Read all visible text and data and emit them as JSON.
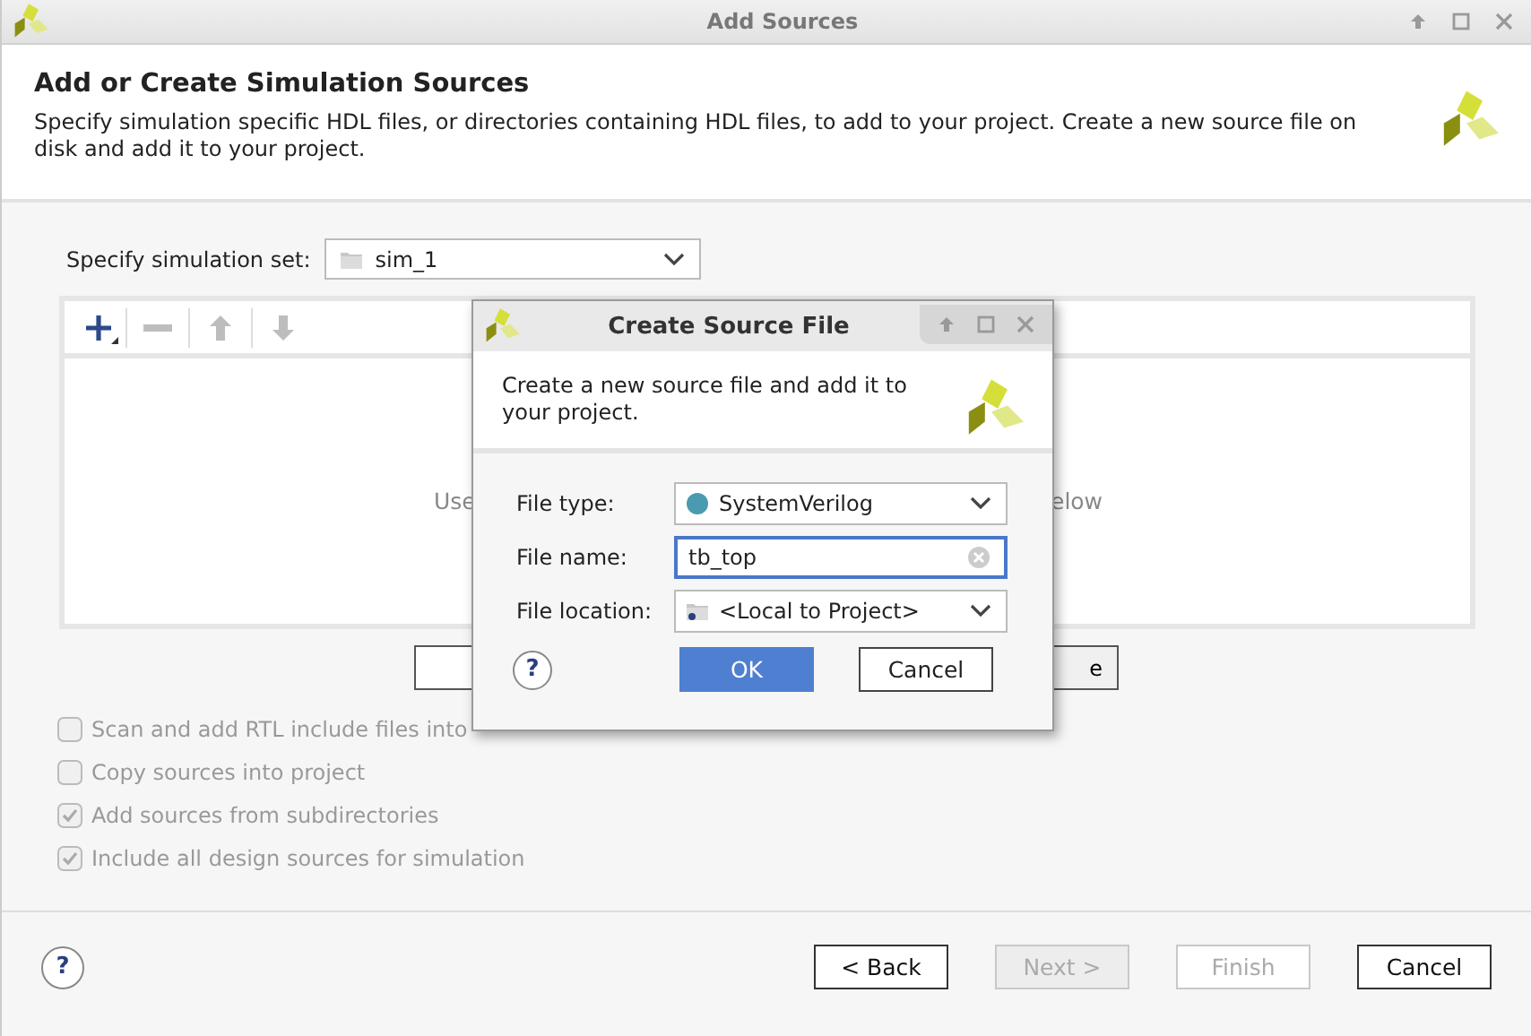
{
  "window": {
    "title": "Add Sources"
  },
  "header": {
    "title": "Add or Create Simulation Sources",
    "description": "Specify simulation specific HDL files, or directories containing HDL files, to add to your project. Create a new source file on disk and add it to your project."
  },
  "simulation_set": {
    "label": "Specify simulation set:",
    "value": "sim_1"
  },
  "toolbar": [
    {
      "kind": "add",
      "disabled": false
    },
    {
      "kind": "remove",
      "disabled": true
    },
    {
      "kind": "up",
      "disabled": true
    },
    {
      "kind": "down",
      "disabled": true
    }
  ],
  "hint_fragments": [
    "Use",
    "elow"
  ],
  "panel_button_fragment": "e",
  "help_label": "?",
  "options": [
    {
      "label": "Scan and add RTL include files into",
      "checked": false,
      "disabled": true
    },
    {
      "label": "Copy sources into project",
      "checked": false,
      "disabled": true
    },
    {
      "label": "Add sources from subdirectories",
      "checked": true,
      "disabled": true
    },
    {
      "label": "Include all design sources for simulation",
      "checked": true,
      "disabled": true
    }
  ],
  "footer_buttons": [
    {
      "label": "< Back",
      "disabled": false,
      "kind": "plain"
    },
    {
      "label": "Next >",
      "disabled": true,
      "kind": "filled"
    },
    {
      "label": "Finish",
      "disabled": true,
      "kind": "plain"
    },
    {
      "label": "Cancel",
      "disabled": false,
      "kind": "plain"
    }
  ],
  "dialog": {
    "title": "Create Source File",
    "description": "Create a new source file and add it to your project.",
    "help_label": "?",
    "fields": [
      {
        "kind": "select",
        "label": "File type:",
        "value": "SystemVerilog",
        "focused": false
      },
      {
        "kind": "text",
        "label": "File name:",
        "value": "tb_top",
        "focused": true
      },
      {
        "kind": "select",
        "label": "File location:",
        "value": "<Local to Project>",
        "focused": false
      }
    ],
    "buttons": [
      {
        "label": "OK",
        "default": true
      },
      {
        "label": "Cancel",
        "default": false
      }
    ]
  }
}
